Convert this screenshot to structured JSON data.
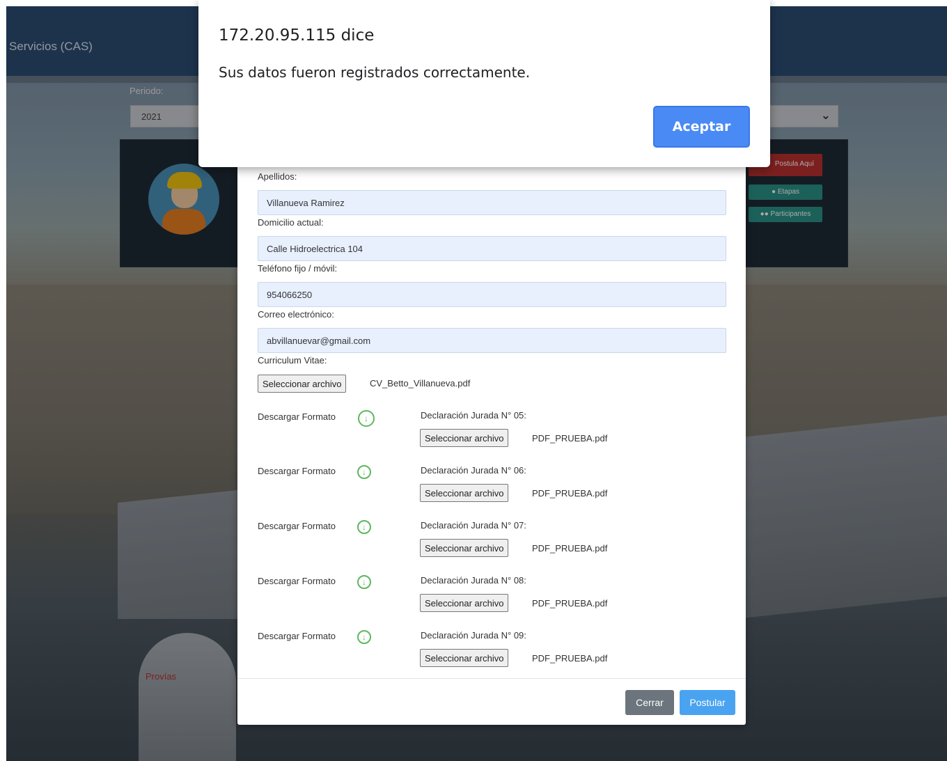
{
  "alert": {
    "title": "172.20.95.115 dice",
    "message": "Sus datos fueron registrados correctamente.",
    "accept_label": "Aceptar"
  },
  "background_page": {
    "brand": "Servicios (CAS)",
    "periodo_label": "Periodo:",
    "periodo_value": "2021",
    "card_buttons": {
      "postula": "Postula Aquí",
      "etapas": "Etapas",
      "participantes": "Participantes"
    },
    "sign_text": "Provías"
  },
  "form": {
    "fields": [
      {
        "label": "Apellidos:",
        "value": "Villanueva Ramirez"
      },
      {
        "label": "Domicilio actual:",
        "value": "Calle Hidroelectrica 104"
      },
      {
        "label": "Teléfono fijo / móvil:",
        "value": "954066250"
      },
      {
        "label": "Correo electrónico:",
        "value": "abvillanuevar@gmail.com"
      }
    ],
    "cv": {
      "label": "Curriculum Vitae:",
      "button_label": "Seleccionar archivo",
      "file_name": "CV_Betto_Villanueva.pdf"
    },
    "declarations": [
      {
        "download_label": "Descargar Formato",
        "label": "Declaración Jurada N° 05:",
        "button_label": "Seleccionar archivo",
        "file_name": "PDF_PRUEBA.pdf"
      },
      {
        "download_label": "Descargar Formato",
        "label": "Declaración Jurada N° 06:",
        "button_label": "Seleccionar archivo",
        "file_name": "PDF_PRUEBA.pdf"
      },
      {
        "download_label": "Descargar Formato",
        "label": "Declaración Jurada N° 07:",
        "button_label": "Seleccionar archivo",
        "file_name": "PDF_PRUEBA.pdf"
      },
      {
        "download_label": "Descargar Formato",
        "label": "Declaración Jurada N° 08:",
        "button_label": "Seleccionar archivo",
        "file_name": "PDF_PRUEBA.pdf"
      },
      {
        "download_label": "Descargar Formato",
        "label": "Declaración Jurada N° 09:",
        "button_label": "Seleccionar archivo",
        "file_name": "PDF_PRUEBA.pdf"
      }
    ],
    "close_label": "Cerrar",
    "submit_label": "Postular"
  },
  "icons": {
    "download": "download-circle-icon",
    "chevron": "chevron-down-icon",
    "etapas": "globe-icon",
    "participantes": "users-icon"
  }
}
